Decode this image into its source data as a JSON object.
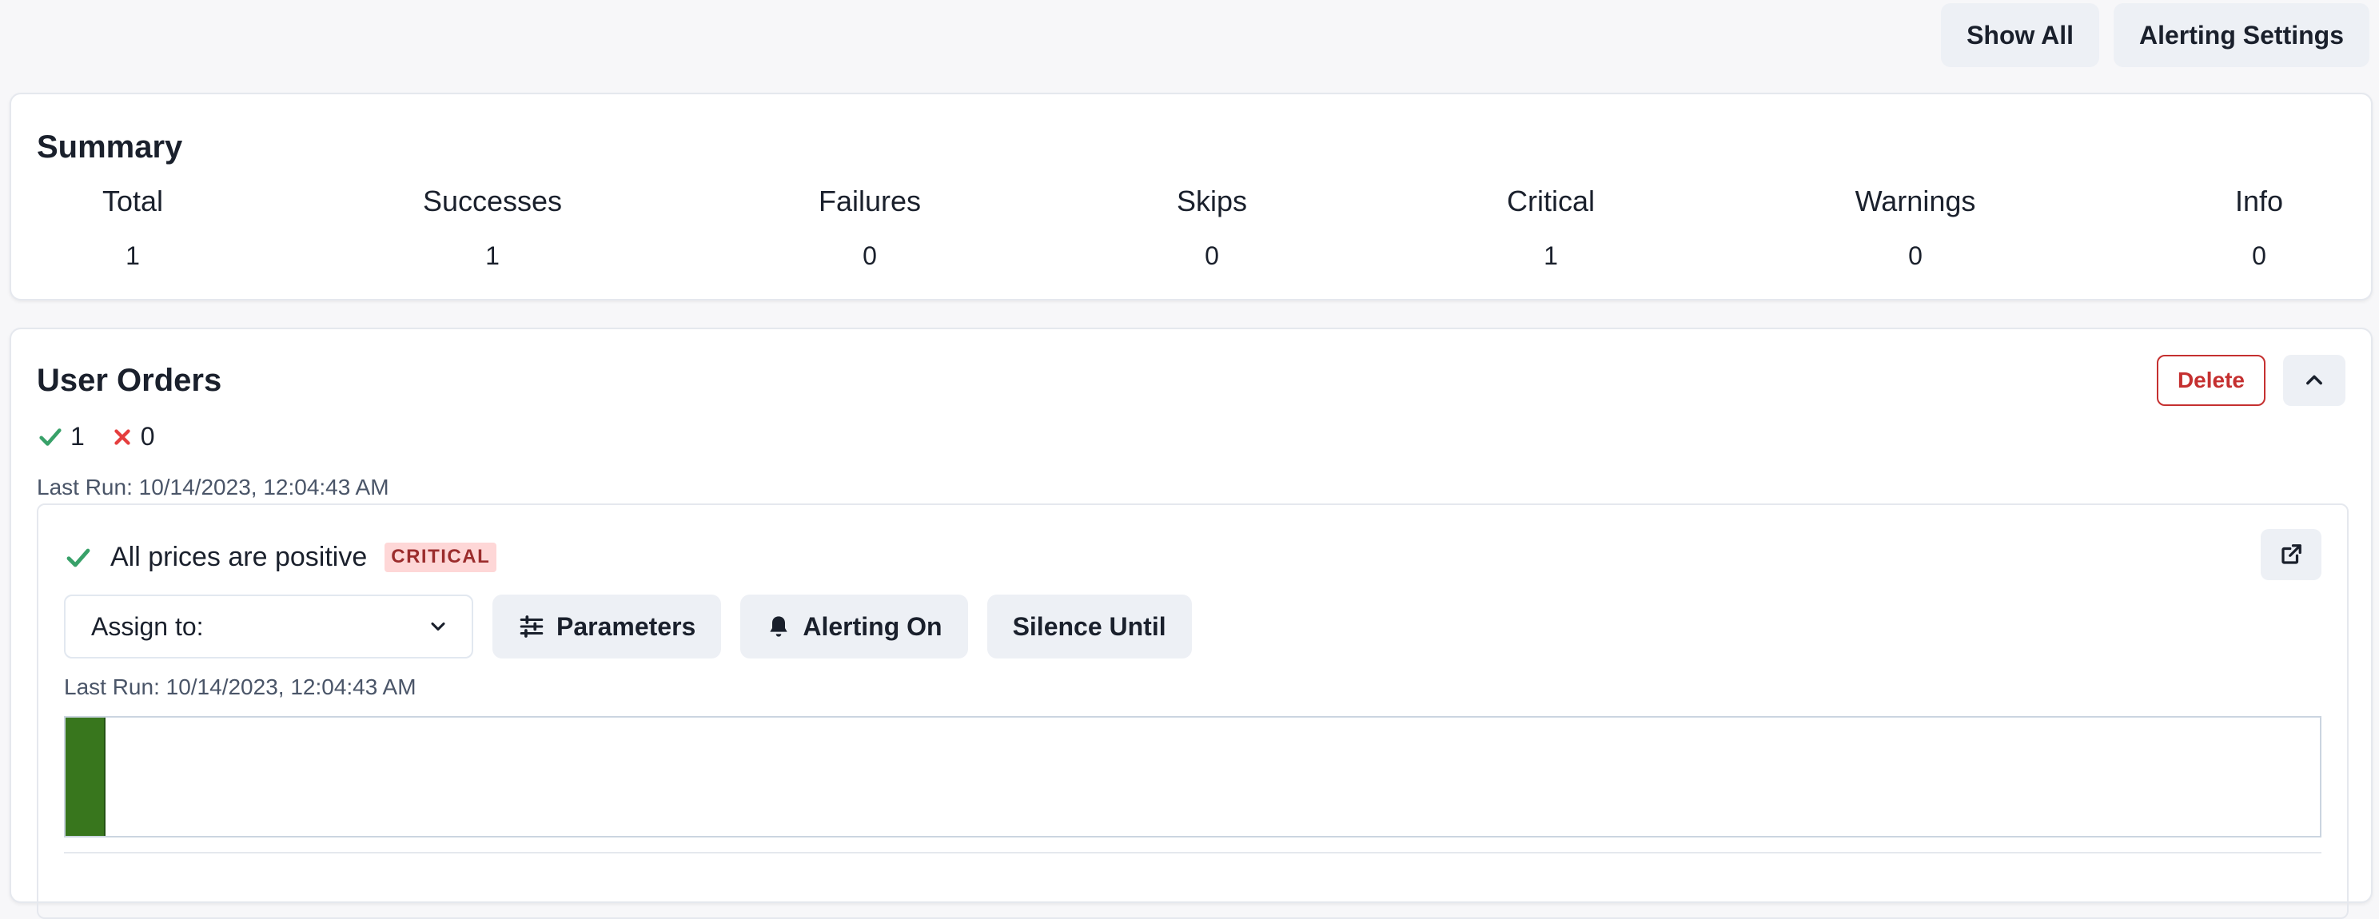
{
  "header": {
    "show_all_label": "Show All",
    "alerting_settings_label": "Alerting Settings"
  },
  "summary": {
    "title": "Summary",
    "stats": [
      {
        "label": "Total",
        "value": "1"
      },
      {
        "label": "Successes",
        "value": "1"
      },
      {
        "label": "Failures",
        "value": "0"
      },
      {
        "label": "Skips",
        "value": "0"
      },
      {
        "label": "Critical",
        "value": "1"
      },
      {
        "label": "Warnings",
        "value": "0"
      },
      {
        "label": "Info",
        "value": "0"
      }
    ]
  },
  "suite": {
    "title": "User Orders",
    "delete_label": "Delete",
    "pass_count": "1",
    "fail_count": "0",
    "last_run": "Last Run: 10/14/2023, 12:04:43 AM",
    "check": {
      "name": "All prices are positive",
      "severity": "CRITICAL",
      "assign_placeholder": "Assign to:",
      "parameters_label": "Parameters",
      "alerting_label": "Alerting On",
      "silence_label": "Silence Until",
      "last_run": "Last Run: 10/14/2023, 12:04:43 AM",
      "run_history": [
        {
          "status": "success",
          "color": "#38761d"
        }
      ]
    }
  },
  "colors": {
    "success": "#38a169",
    "failure": "#e53e3e",
    "danger": "#c53030",
    "badge_bg": "#fed7d7",
    "button_bg": "#edf0f5",
    "run_success": "#38761d"
  }
}
